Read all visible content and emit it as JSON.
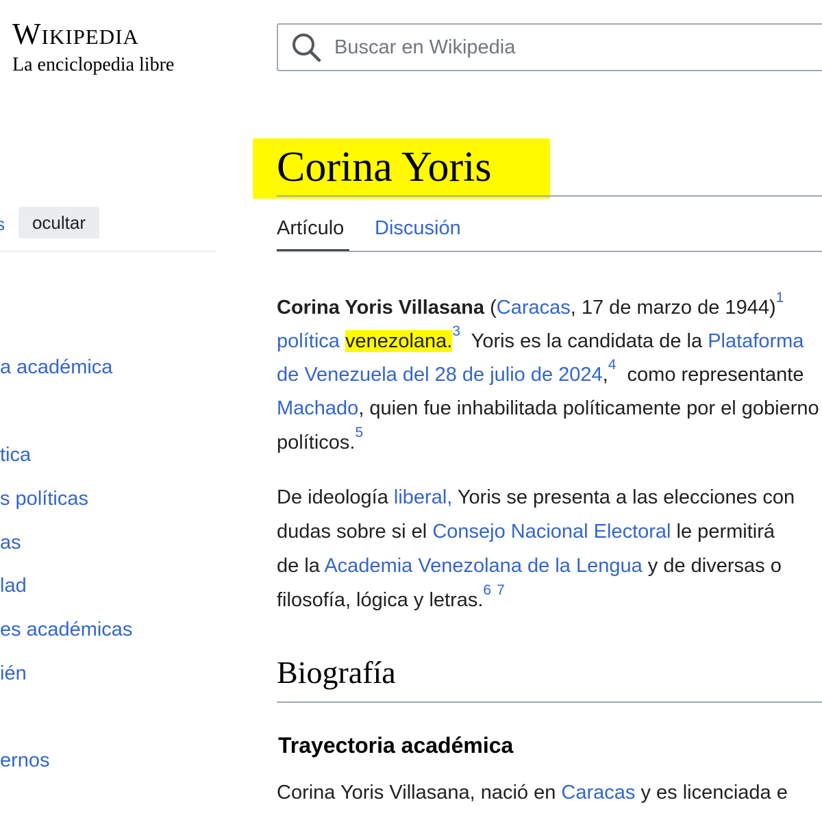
{
  "logo": {
    "wordmark": "Wikipedia",
    "tagline": "La enciclopedia libre"
  },
  "search": {
    "placeholder": "Buscar en Wikipedia",
    "icon": "search-icon"
  },
  "toc": {
    "header_fragment": "s",
    "hide_label": "ocultar",
    "items": [
      "a académica",
      "tica",
      "s políticas",
      "as",
      "lad",
      "es académicas",
      "ién",
      "ernos"
    ]
  },
  "article": {
    "title": "Corina Yoris",
    "tabs": {
      "article": "Artículo",
      "talk": "Discusión"
    },
    "p1": {
      "l1": {
        "bold": "Corina Yoris Villasana",
        "open": " (",
        "caracas": "Caracas",
        "date": ", 17 de marzo de 1944)",
        "sup": "1"
      },
      "l2": {
        "politica": "política",
        "sp": " ",
        "venez": "venezolana.",
        "sup": "3",
        "text": "  Yoris es la candidata de la ",
        "link": "Plataforma"
      },
      "l3": {
        "link": "de Venezuela del 28 de julio de 2024",
        "comma": ",",
        "sup": "4",
        "text": "  como representante"
      },
      "l4": {
        "link": "Machado",
        "text": ", quien fue inhabilitada políticamente por el gobierno"
      },
      "l5": {
        "text": "políticos.",
        "sup": "5"
      }
    },
    "p2": {
      "l1": {
        "text1": "De ideología ",
        "link": "liberal,",
        "text2": " Yoris se presenta a las elecciones con"
      },
      "l2": {
        "text1": "dudas sobre si el ",
        "link": "Consejo Nacional Electoral",
        "text2": " le permitirá"
      },
      "l3": {
        "text1": "de la ",
        "link": "Academia Venezolana de la Lengua",
        "text2": " y de diversas o"
      },
      "l4": {
        "text": "filosofía, lógica y letras.",
        "sup1": "6",
        "sup2": "7"
      }
    },
    "section_heading": "Biografía",
    "subsection_heading": "Trayectoria académica",
    "p3": {
      "text1": "Corina Yoris Villasana, nació en ",
      "link": "Caracas",
      "text2": " y es licenciada e"
    }
  },
  "colors": {
    "link": "#3366cc",
    "highlight": "#fffa00",
    "text": "#202122"
  }
}
